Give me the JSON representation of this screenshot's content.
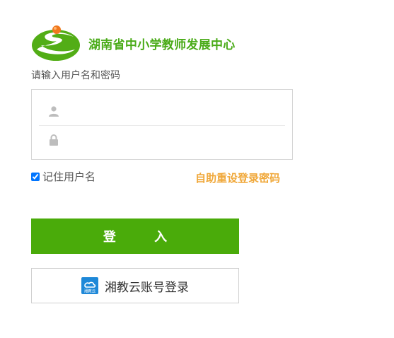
{
  "header": {
    "org_title": "湖南省中小学教师发展中心"
  },
  "form": {
    "prompt": "请输入用户名和密码",
    "username_value": "",
    "password_value": "",
    "remember_label": "记住用户名",
    "remember_checked": true,
    "reset_link": "自助重设登录密码"
  },
  "actions": {
    "login_label": "登 入",
    "cloud_login_label": "湘教云账号登录",
    "cloud_logo_text": "湘教云"
  },
  "colors": {
    "brand_green": "#4aab18",
    "button_green": "#4aab0a",
    "link_orange": "#f0a83a",
    "cloud_blue": "#1e88d8"
  },
  "icons": {
    "logo": "center-logo-icon",
    "username": "user-icon",
    "password": "lock-icon",
    "cloud": "xiangjiaoyun-icon"
  }
}
